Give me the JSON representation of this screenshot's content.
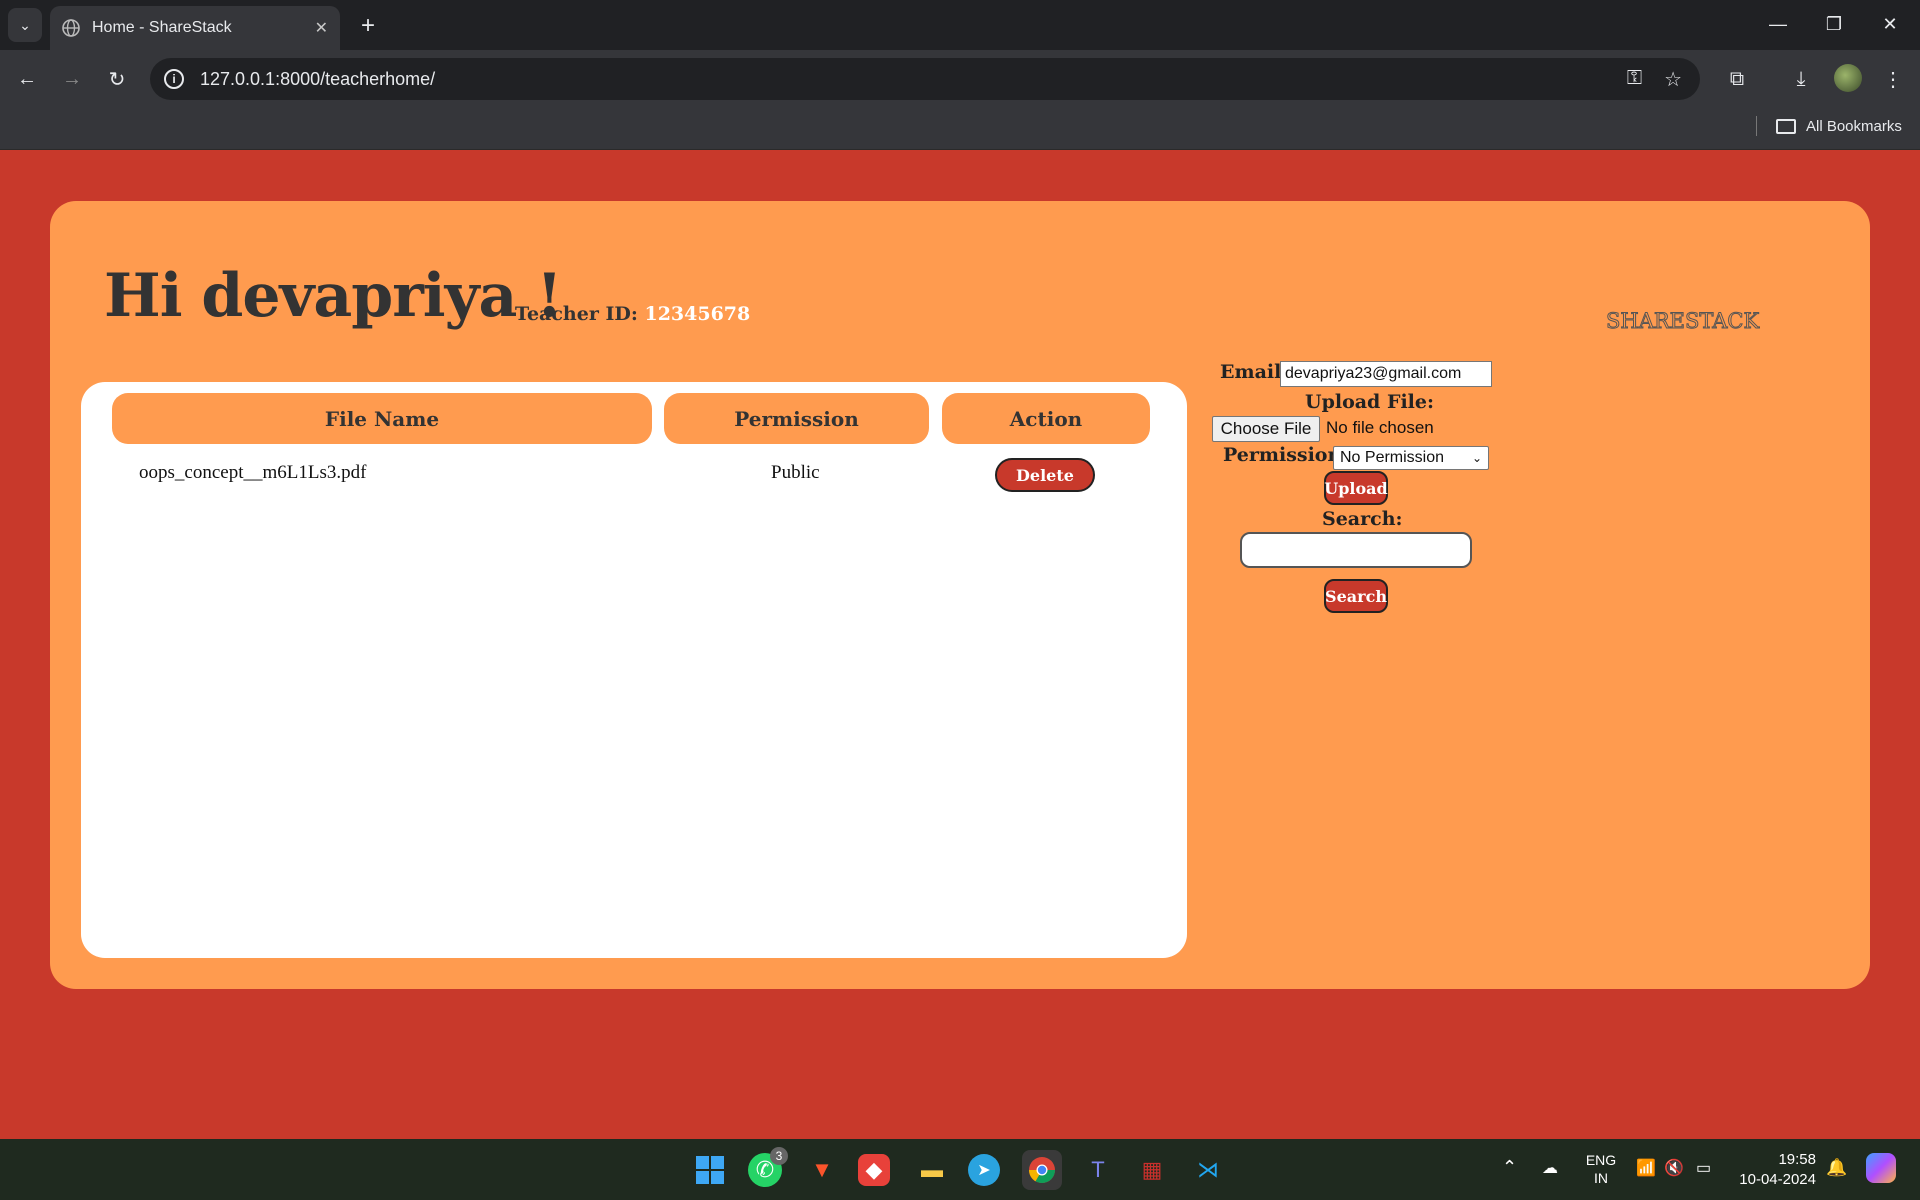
{
  "browser": {
    "tab_title": "Home - ShareStack",
    "url": "127.0.0.1:8000/teacherhome/",
    "bookmarks_label": "All Bookmarks"
  },
  "header": {
    "greeting": "Hi devapriya !",
    "teacher_id_label": "Teacher ID:",
    "teacher_id_value": "12345678",
    "brand": "SHARESTACK"
  },
  "table": {
    "columns": [
      "File Name",
      "Permission",
      "Action"
    ],
    "rows": [
      {
        "file_name": "oops_concept__m6L1Ls3.pdf",
        "permission": "Public",
        "action": "Delete"
      }
    ]
  },
  "form": {
    "email_label": "Email:",
    "email_value": "devapriya23@gmail.com",
    "upload_file_label": "Upload File:",
    "choose_file_label": "Choose File",
    "no_file_text": "No file chosen",
    "permission_label": "Permission:",
    "permission_selected": "No Permission",
    "upload_button": "Upload",
    "search_label": "Search:",
    "search_value": "",
    "search_button": "Search"
  },
  "taskbar": {
    "whatsapp_badge": "3",
    "language": "ENG",
    "region": "IN",
    "time": "19:58",
    "date": "10-04-2024"
  },
  "colors": {
    "page_bg": "#c8392b",
    "panel_bg": "#ff9b4f",
    "button_bg": "#c8392b"
  }
}
